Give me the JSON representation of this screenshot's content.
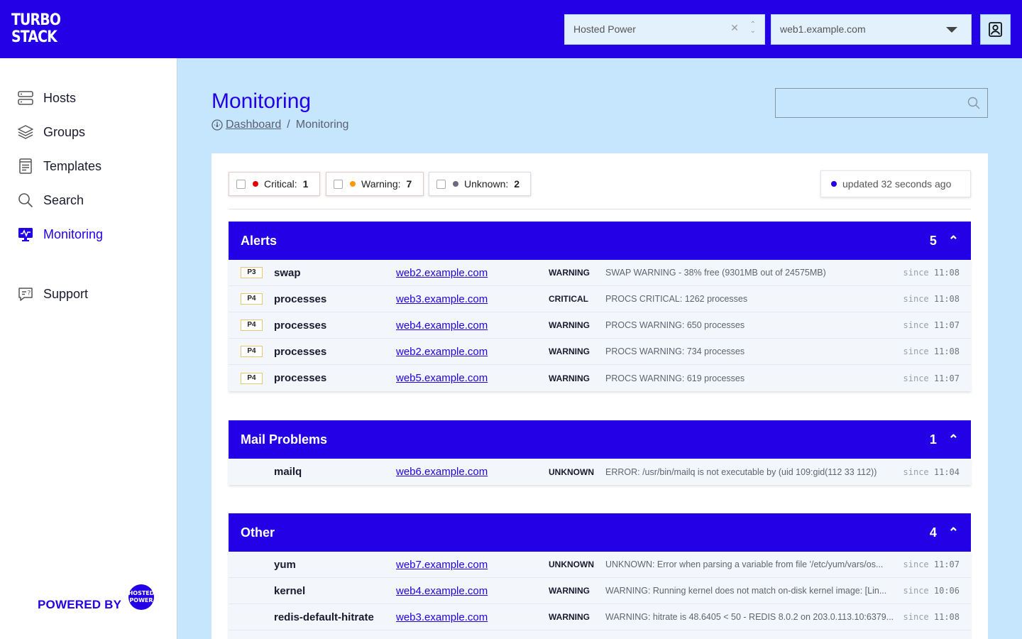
{
  "logo": {
    "line1": "TURBO",
    "line2": "STACK"
  },
  "topbar": {
    "org_select": "Hosted Power",
    "host_select": "web1.example.com"
  },
  "sidebar": {
    "items": [
      {
        "label": "Hosts",
        "icon": "server-icon"
      },
      {
        "label": "Groups",
        "icon": "layers-icon"
      },
      {
        "label": "Templates",
        "icon": "document-icon"
      },
      {
        "label": "Search",
        "icon": "search-icon"
      },
      {
        "label": "Monitoring",
        "icon": "monitor-icon",
        "active": true
      },
      {
        "label": "Support",
        "icon": "support-chat-icon"
      }
    ],
    "powered_by": "POWERED BY",
    "powered_logo": "HOSTED POWER"
  },
  "page": {
    "title": "Monitoring",
    "breadcrumb": {
      "home": "Dashboard",
      "separator": "/",
      "current": "Monitoring"
    },
    "search_placeholder": ""
  },
  "filters": {
    "critical": {
      "label": "Critical:",
      "count": "1",
      "color": "#e00000"
    },
    "warning": {
      "label": "Warning:",
      "count": "7",
      "color": "#ff9900"
    },
    "unknown": {
      "label": "Unknown:",
      "count": "2",
      "color": "#6b6b80"
    }
  },
  "status": {
    "updated": "updated 32 seconds ago",
    "color": "#2300e6"
  },
  "groups": [
    {
      "title": "Alerts",
      "count": "5",
      "rows": [
        {
          "priority": "P3",
          "service": "swap",
          "host": "web2.example.com",
          "state": "WARNING",
          "message": "SWAP WARNING - 38% free (9301MB out of 24575MB)",
          "since": "since",
          "time": "11:08"
        },
        {
          "priority": "P4",
          "service": "processes",
          "host": "web3.example.com",
          "state": "CRITICAL",
          "message": "PROCS CRITICAL: 1262 processes",
          "since": "since",
          "time": "11:08"
        },
        {
          "priority": "P4",
          "service": "processes",
          "host": "web4.example.com",
          "state": "WARNING",
          "message": "PROCS WARNING: 650 processes",
          "since": "since",
          "time": "11:07"
        },
        {
          "priority": "P4",
          "service": "processes",
          "host": "web2.example.com",
          "state": "WARNING",
          "message": "PROCS WARNING: 734 processes",
          "since": "since",
          "time": "11:08"
        },
        {
          "priority": "P4",
          "service": "processes",
          "host": "web5.example.com",
          "state": "WARNING",
          "message": "PROCS WARNING: 619 processes",
          "since": "since",
          "time": "11:07"
        }
      ]
    },
    {
      "title": "Mail Problems",
      "count": "1",
      "rows": [
        {
          "service": "mailq",
          "host": "web6.example.com",
          "state": "UNKNOWN",
          "message": "ERROR: /usr/bin/mailq is not executable by (uid 109:gid(112 33 112))",
          "since": "since",
          "time": "11:04"
        }
      ]
    },
    {
      "title": "Other",
      "count": "4",
      "rows": [
        {
          "service": "yum",
          "host": "web7.example.com",
          "state": "UNKNOWN",
          "message": "UNKNOWN: Error when parsing a variable from file '/etc/yum/vars/os...",
          "since": "since",
          "time": "11:07"
        },
        {
          "service": "kernel",
          "host": "web4.example.com",
          "state": "WARNING",
          "message": "WARNING: Running kernel does not match on-disk kernel image: [Lin...",
          "since": "since",
          "time": "10:06"
        },
        {
          "service": "redis-default-hitrate",
          "host": "web3.example.com",
          "state": "WARNING",
          "message": "WARNING: hitrate is 48.6405 < 50 - REDIS 8.0.2 on 203.0.113.10:6379...",
          "since": "since",
          "time": "11:08"
        }
      ]
    }
  ]
}
